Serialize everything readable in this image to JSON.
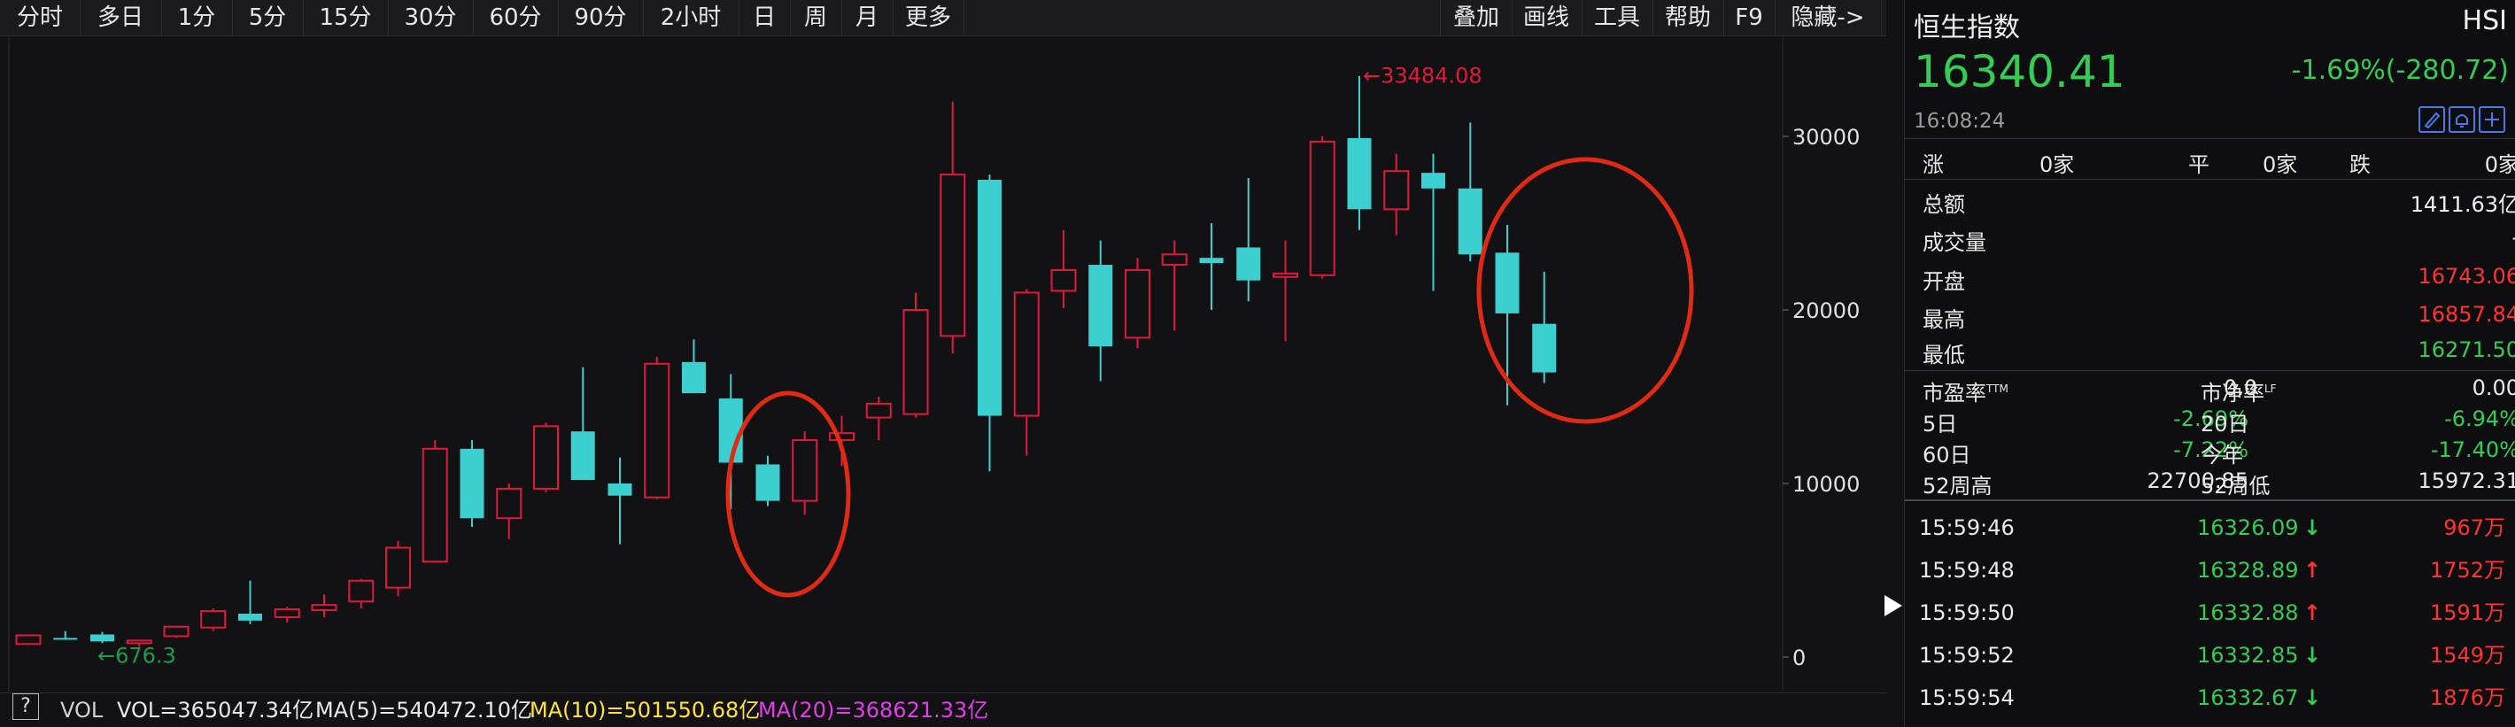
{
  "toolbar": {
    "periods": [
      "分时",
      "多日",
      "1分",
      "5分",
      "15分",
      "30分",
      "60分",
      "90分",
      "2小时",
      "日",
      "周",
      "月",
      "更多"
    ],
    "tools": [
      "叠加",
      "画线",
      "工具",
      "帮助",
      "F9",
      "隐藏->"
    ]
  },
  "chart": {
    "y_ticks": [
      "30000",
      "20000",
      "10000",
      "0"
    ],
    "max_label": "←33484.08",
    "min_label": "←676.3",
    "colors": {
      "up": "#e0193c",
      "down": "#3ccfcf",
      "bg": "#121214",
      "annotation": "#e02a14"
    }
  },
  "chart_data": {
    "type": "candlestick",
    "series": [
      {
        "ohlc": [
          [
            750,
            1300,
            700,
            1250
          ],
          [
            1100,
            1500,
            1000,
            1050
          ],
          [
            1300,
            1450,
            800,
            900
          ],
          [
            800,
            1000,
            600,
            950
          ],
          [
            1200,
            1800,
            1100,
            1750
          ],
          [
            1700,
            2800,
            1500,
            2650
          ],
          [
            2500,
            4400,
            1900,
            2100
          ],
          [
            2300,
            2900,
            2000,
            2750
          ],
          [
            2700,
            3600,
            2300,
            3000
          ],
          [
            3200,
            4500,
            2800,
            4400
          ],
          [
            4000,
            6700,
            3500,
            6300
          ],
          [
            5500,
            12500,
            5500,
            12000
          ],
          [
            12000,
            12500,
            7500,
            8000
          ],
          [
            8000,
            10000,
            6800,
            9700
          ],
          [
            9700,
            13500,
            9500,
            13300
          ],
          [
            13000,
            16700,
            10500,
            10200
          ],
          [
            10000,
            11500,
            6500,
            9300
          ],
          [
            9200,
            17300,
            9100,
            16900
          ],
          [
            17000,
            18300,
            15500,
            15200
          ],
          [
            14900,
            16300,
            8500,
            11200
          ],
          [
            11100,
            11600,
            8700,
            9000
          ],
          [
            9000,
            13000,
            8200,
            12500
          ],
          [
            12500,
            13900,
            11000,
            12900
          ],
          [
            13800,
            15000,
            12500,
            14600
          ],
          [
            14000,
            21000,
            13800,
            20000
          ],
          [
            18500,
            32000,
            17500,
            27800
          ],
          [
            27500,
            27800,
            10700,
            13900
          ],
          [
            13900,
            21200,
            11600,
            21000
          ],
          [
            21100,
            24600,
            20100,
            22300
          ],
          [
            22600,
            24000,
            15900,
            17900
          ],
          [
            18400,
            23000,
            17800,
            22300
          ],
          [
            22600,
            24000,
            18800,
            23200
          ],
          [
            23000,
            25000,
            20000,
            22700
          ],
          [
            23600,
            27600,
            20500,
            21700
          ],
          [
            21900,
            24000,
            18200,
            22100
          ],
          [
            22000,
            30000,
            21800,
            29700
          ],
          [
            29900,
            33484.08,
            24600,
            25800
          ],
          [
            25800,
            29000,
            24300,
            28000
          ],
          [
            27900,
            29000,
            21100,
            27000
          ],
          [
            27000,
            30800,
            22800,
            23200
          ],
          [
            23300,
            24900,
            14500,
            19800
          ],
          [
            19200,
            22200,
            15800,
            16400
          ]
        ]
      }
    ],
    "ylim": [
      0,
      35000
    ],
    "extremes": {
      "max": 33484.08,
      "min": 676.3
    }
  },
  "volbar": {
    "help": "?",
    "vol": "VOL",
    "vol_value": "VOL=365047.34亿",
    "ma5": "MA(5)=540472.10亿",
    "ma10": "MA(10)=501550.68亿",
    "ma20": "MA(20)=368621.33亿",
    "colors": {
      "vol": "#e8e8e8",
      "ma5": "#e8e8e8",
      "ma10": "#ffe23a",
      "ma20": "#e23ee8"
    }
  },
  "quote": {
    "name": "恒生指数",
    "code": "HSI",
    "price": "16340.41",
    "change": "-1.69%(-280.72)",
    "time": "16:08:24",
    "breadth": {
      "up_label": "涨",
      "up_count": "0家",
      "flat_label": "平",
      "flat_count": "0家",
      "down_label": "跌",
      "down_count": "0家"
    },
    "stats": [
      {
        "label": "总额",
        "value": "1411.63亿",
        "color": "white"
      },
      {
        "label": "成交量",
        "value": "-",
        "color": "white"
      },
      {
        "label": "开盘",
        "value": "16743.06",
        "color": "red"
      },
      {
        "label": "最高",
        "value": "16857.84",
        "color": "red"
      },
      {
        "label": "最低",
        "value": "16271.50",
        "color": "green"
      }
    ],
    "ratios": {
      "pe_label": "市盈率",
      "pe_sup": "TTM",
      "pe_value": "0.0",
      "pb_label": "市净率",
      "pb_sup": "LF",
      "pb_value": "0.00"
    },
    "periods": [
      {
        "l1": "5日",
        "v1": "-2.69%",
        "l2": "20日",
        "v2": "-6.94%"
      },
      {
        "l1": "60日",
        "v1": "-7.22%",
        "l2": "今年",
        "v2": "-17.40%"
      }
    ],
    "week52": {
      "high_label": "52周高",
      "high_value": "22700.85",
      "low_label": "52周低",
      "low_value": "15972.31"
    },
    "ticks": [
      {
        "time": "15:59:46",
        "price": "16326.09",
        "dir": "↓",
        "vol": "967万"
      },
      {
        "time": "15:59:48",
        "price": "16328.89",
        "dir": "↑",
        "vol": "1752万"
      },
      {
        "time": "15:59:50",
        "price": "16332.88",
        "dir": "↑",
        "vol": "1591万"
      },
      {
        "time": "15:59:52",
        "price": "16332.85",
        "dir": "↓",
        "vol": "1549万"
      },
      {
        "time": "15:59:54",
        "price": "16332.67",
        "dir": "↓",
        "vol": "1876万"
      }
    ]
  }
}
